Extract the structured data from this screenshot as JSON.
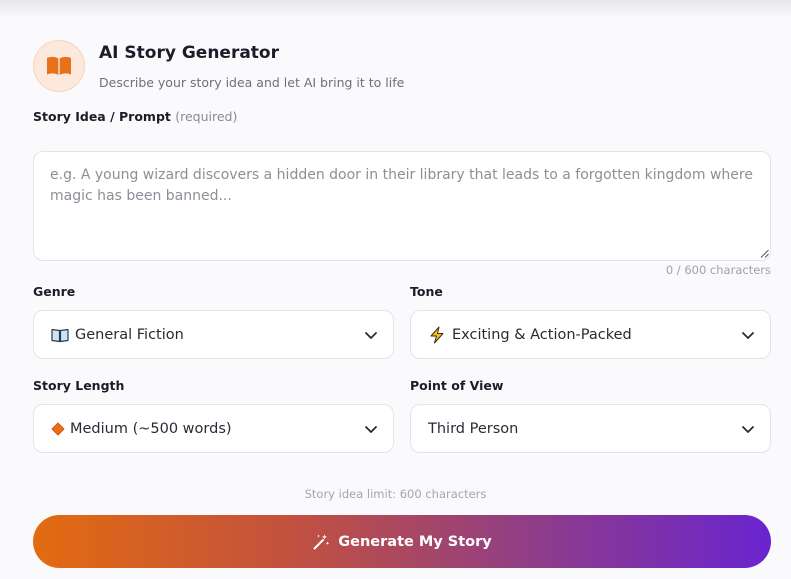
{
  "header": {
    "title": "AI Story Generator",
    "subtitle": "Describe your story idea and let AI bring it to life",
    "icon": "open-book-icon",
    "accent": "#e36b10"
  },
  "prompt": {
    "label": "Story Idea / Prompt",
    "required_note": "(required)",
    "value": "",
    "placeholder": "e.g. A young wizard discovers a hidden door in their library that leads to a forgotten kingdom where magic has been banned...",
    "counter": "0 / 600 characters"
  },
  "genre": {
    "label": "Genre",
    "selected": "General Fiction",
    "icon": "open-book-emoji-icon"
  },
  "tone": {
    "label": "Tone",
    "selected": "Exciting & Action-Packed",
    "icon": "lightning-icon"
  },
  "length": {
    "label": "Story Length",
    "selected": "Medium (~500 words)",
    "icon": "orange-diamond-icon"
  },
  "pov": {
    "label": "Point of View",
    "selected": "Third Person"
  },
  "limit_note": "Story idea limit: 600 characters",
  "generate": {
    "label": "Generate My Story",
    "icon": "magic-wand-icon",
    "gradient_start": "#e36b10",
    "gradient_end": "#6a24cf"
  }
}
